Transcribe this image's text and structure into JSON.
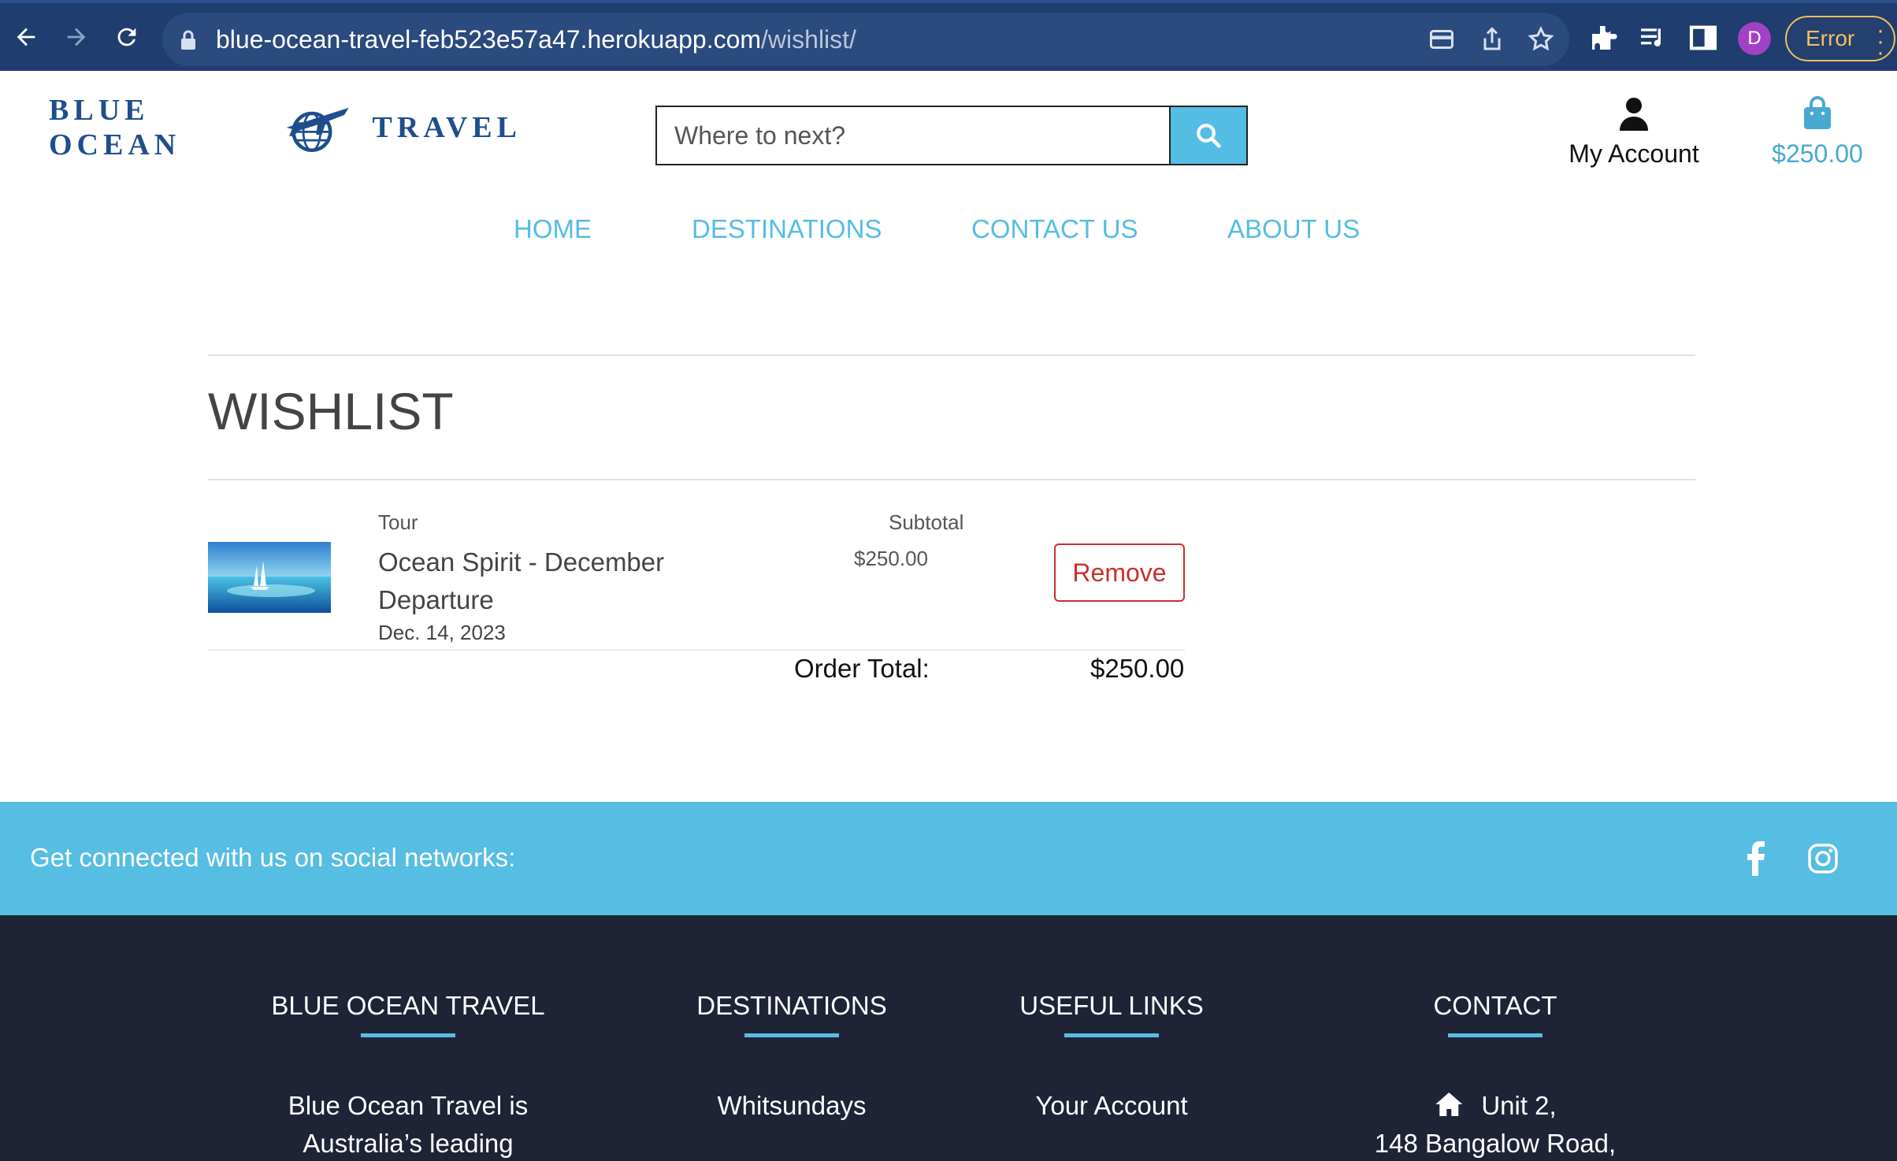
{
  "browser": {
    "url_host": "blue-ocean-travel-feb523e57a47.herokuapp.com",
    "url_path": "/wishlist/",
    "profile_initial": "D",
    "error_label": "Error"
  },
  "header": {
    "logo_left": "BLUE OCEAN",
    "logo_right": "TRAVEL",
    "search_placeholder": "Where to next?",
    "account_label": "My Account",
    "bag_total": "$250.00"
  },
  "nav": {
    "items": [
      {
        "label": "HOME"
      },
      {
        "label": "DESTINATIONS"
      },
      {
        "label": "CONTACT US"
      },
      {
        "label": "ABOUT US"
      }
    ]
  },
  "wishlist": {
    "title": "WISHLIST",
    "col_tour": "Tour",
    "col_subtotal": "Subtotal",
    "items": [
      {
        "name": "Ocean Spirit - December Departure",
        "date": "Dec. 14, 2023",
        "subtotal": "$250.00",
        "remove_label": "Remove"
      }
    ],
    "order_total_label": "Order Total:",
    "order_total_value": "$250.00"
  },
  "social": {
    "text": "Get connected with us on social networks:",
    "icons": [
      "facebook-icon",
      "instagram-icon"
    ]
  },
  "footer": {
    "col1": {
      "heading": "BLUE OCEAN TRAVEL",
      "line1": "Blue Ocean Travel is",
      "line2": "Australia’s leading"
    },
    "col2": {
      "heading": "DESTINATIONS",
      "line1": "Whitsundays"
    },
    "col3": {
      "heading": "USEFUL LINKS",
      "line1": "Your Account"
    },
    "col4": {
      "heading": "CONTACT",
      "line1": "Unit 2,",
      "line2": "148 Bangalow Road,"
    }
  },
  "colors": {
    "brand_blue": "#1f4e8c",
    "accent": "#54bde3",
    "remove_red": "#c9302c",
    "footer_bg": "#1e2435",
    "chrome_bg": "#1f3d6e"
  }
}
